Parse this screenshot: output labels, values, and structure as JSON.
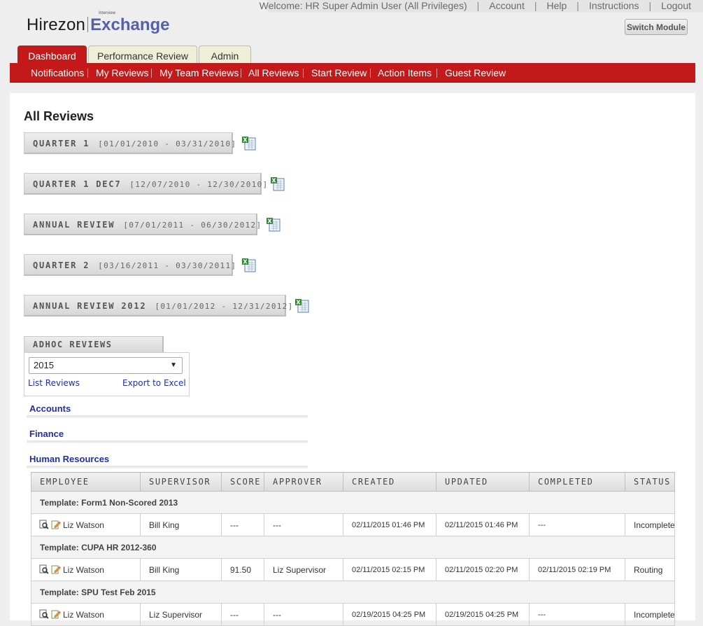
{
  "top_links": {
    "welcome": "Welcome: HR Super Admin User (All Privileges)",
    "account": "Account",
    "help": "Help",
    "instructions": "Instructions",
    "logout": "Logout"
  },
  "logo": {
    "brand": "Hirezon",
    "superscript": "Interview",
    "product": "Exchange"
  },
  "switch_module": "Switch Module",
  "tabs": [
    {
      "label": "Dashboard",
      "active": true
    },
    {
      "label": "Performance Review",
      "active": false
    },
    {
      "label": "Admin",
      "active": false
    }
  ],
  "subnav": [
    "Notifications",
    "My Reviews",
    "My Team Reviews",
    "All Reviews",
    "Start Review",
    "Action Items",
    "Guest Review"
  ],
  "page_title": "All Reviews",
  "periods": [
    {
      "name": "QUARTER 1",
      "dates": "[01/01/2010 - 03/31/2010]"
    },
    {
      "name": "QUARTER 1 DEC7",
      "dates": "[12/07/2010 - 12/30/2010]"
    },
    {
      "name": "ANNUAL REVIEW",
      "dates": "[07/01/2011 - 06/30/2012]"
    },
    {
      "name": "QUARTER 2",
      "dates": "[03/16/2011 - 03/30/2011]"
    },
    {
      "name": "ANNUAL REVIEW 2012",
      "dates": "[01/01/2012 - 12/31/2012]"
    }
  ],
  "adhoc": {
    "title": "ADHOC REVIEWS",
    "year_selected": "2015",
    "list_reviews": "List Reviews",
    "export_excel": "Export to Excel"
  },
  "departments": [
    "Accounts",
    "Finance",
    "Human Resources"
  ],
  "table": {
    "headers": [
      "EMPLOYEE",
      "SUPERVISOR",
      "SCORE",
      "APPROVER",
      "CREATED",
      "UPDATED",
      "COMPLETED",
      "STATUS"
    ],
    "groups": [
      {
        "template": "Template: Form1 Non-Scored 2013",
        "row": {
          "employee": "Liz Watson",
          "supervisor": "Bill King",
          "score": "---",
          "approver": "---",
          "created": "02/11/2015 01:46 PM",
          "updated": "02/11/2015 01:46 PM",
          "completed": "---",
          "status": "Incomplete"
        }
      },
      {
        "template": "Template: CUPA HR 2012-360",
        "row": {
          "employee": "Liz Watson",
          "supervisor": "Bill King",
          "score": "91.50",
          "approver": "Liz Supervisor",
          "created": "02/11/2015 02:15 PM",
          "updated": "02/11/2015 02:20 PM",
          "completed": "02/11/2015 02:19 PM",
          "status": "Routing"
        }
      },
      {
        "template": "Template: SPU Test Feb 2015",
        "row": {
          "employee": "Liz Watson",
          "supervisor": "Liz Supervisor",
          "score": "---",
          "approver": "---",
          "created": "02/19/2015 04:25 PM",
          "updated": "02/19/2015 04:25 PM",
          "completed": "---",
          "status": "Incomplete"
        }
      }
    ]
  },
  "colors": {
    "nav_red": "#c4191a",
    "link_blue": "#1e2fa7",
    "logo_blue": "#5561a6"
  },
  "icons": {
    "export": "excel-export-icon",
    "view": "view-review-icon",
    "edit": "edit-review-icon"
  }
}
